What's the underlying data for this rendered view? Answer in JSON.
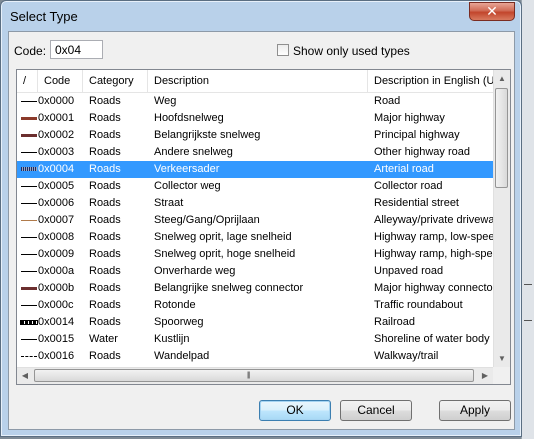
{
  "window": {
    "title": "Select Type",
    "close_glyph": "✕"
  },
  "code": {
    "label": "Code:",
    "value": "0x04"
  },
  "filter": {
    "checked": false,
    "label": "Show only used types"
  },
  "columns": {
    "symbol": "/",
    "code": "Code",
    "category": "Category",
    "description": "Description",
    "english": "Description in English (U.S."
  },
  "rows": [
    {
      "code": "0x0000",
      "category": "Roads",
      "description": "Weg",
      "english": "Road",
      "symbol_color": "#000000",
      "symbol_style": "solid-thin"
    },
    {
      "code": "0x0001",
      "category": "Roads",
      "description": "Hoofdsnelweg",
      "english": "Major highway",
      "symbol_color": "#8b3a2a",
      "symbol_style": "solid-thick"
    },
    {
      "code": "0x0002",
      "category": "Roads",
      "description": "Belangrijkste snelweg",
      "english": "Principal highway",
      "symbol_color": "#6b2e2e",
      "symbol_style": "solid-thick"
    },
    {
      "code": "0x0003",
      "category": "Roads",
      "description": "Andere snelweg",
      "english": "Other highway road",
      "symbol_color": "#000000",
      "symbol_style": "solid-thin"
    },
    {
      "code": "0x0004",
      "category": "Roads",
      "description": "Verkeersader",
      "english": "Arterial road",
      "symbol_color": "#1b2a6b",
      "symbol_style": "hatched",
      "selected": true
    },
    {
      "code": "0x0005",
      "category": "Roads",
      "description": "Collector weg",
      "english": "Collector road",
      "symbol_color": "#000000",
      "symbol_style": "solid-thin"
    },
    {
      "code": "0x0006",
      "category": "Roads",
      "description": "Straat",
      "english": "Residential street",
      "symbol_color": "#000000",
      "symbol_style": "solid-thin"
    },
    {
      "code": "0x0007",
      "category": "Roads",
      "description": "Steeg/Gang/Oprijlaan",
      "english": "Alleyway/private driveway",
      "symbol_color": "#b07a4a",
      "symbol_style": "solid-thin"
    },
    {
      "code": "0x0008",
      "category": "Roads",
      "description": "Snelweg oprit, lage snelheid",
      "english": "Highway ramp, low-speed",
      "symbol_color": "#000000",
      "symbol_style": "solid-thin"
    },
    {
      "code": "0x0009",
      "category": "Roads",
      "description": "Snelweg oprit, hoge snelheid",
      "english": "Highway ramp, high-speed",
      "symbol_color": "#000000",
      "symbol_style": "solid-thin"
    },
    {
      "code": "0x000a",
      "category": "Roads",
      "description": "Onverharde weg",
      "english": "Unpaved road",
      "symbol_color": "#000000",
      "symbol_style": "solid-thin"
    },
    {
      "code": "0x000b",
      "category": "Roads",
      "description": "Belangrijke snelweg connector",
      "english": "Major highway connector",
      "symbol_color": "#6b2e2e",
      "symbol_style": "solid-thick"
    },
    {
      "code": "0x000c",
      "category": "Roads",
      "description": "Rotonde",
      "english": "Traffic roundabout",
      "symbol_color": "#000000",
      "symbol_style": "solid-thin"
    },
    {
      "code": "0x0014",
      "category": "Roads",
      "description": "Spoorweg",
      "english": "Railroad",
      "symbol_color": "#000000",
      "symbol_style": "railroad"
    },
    {
      "code": "0x0015",
      "category": "Water",
      "description": "Kustlijn",
      "english": "Shoreline of water body",
      "symbol_color": "#000000",
      "symbol_style": "solid-thin"
    },
    {
      "code": "0x0016",
      "category": "Roads",
      "description": "Wandelpad",
      "english": "Walkway/trail",
      "symbol_color": "#000000",
      "symbol_style": "dashed"
    }
  ],
  "buttons": {
    "ok": "OK",
    "cancel": "Cancel",
    "apply": "Apply"
  }
}
